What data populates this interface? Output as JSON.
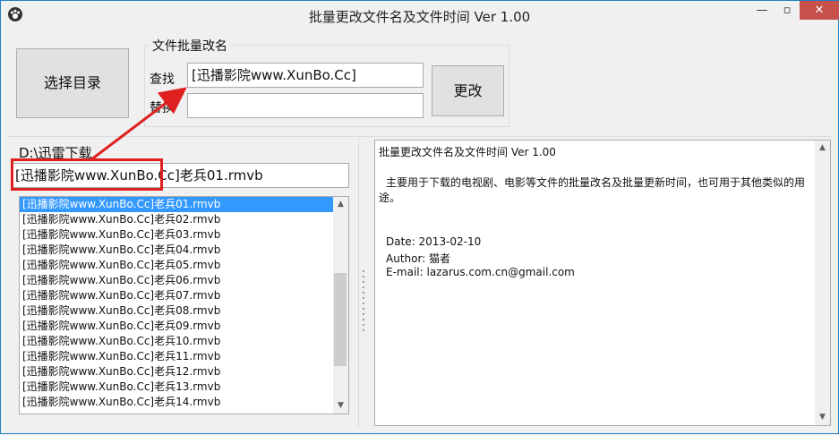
{
  "window": {
    "title": "批量更改文件名及文件时间 Ver 1.00",
    "min_label": "—",
    "max_label": "▫",
    "close_label": "✕"
  },
  "toolbar": {
    "select_dir_label": "选择目录",
    "change_label": "更改"
  },
  "rename_group": {
    "title": "文件批量改名",
    "find_label": "查找",
    "find_value": "[迅播影院www.XunBo.Cc]",
    "replace_label": "替换",
    "replace_value": ""
  },
  "left_pane": {
    "path": "D:\\迅雷下载",
    "current_name": "[迅播影院www.XunBo.Cc]老兵01.rmvb",
    "files": [
      "[迅播影院www.XunBo.Cc]老兵01.rmvb",
      "[迅播影院www.XunBo.Cc]老兵02.rmvb",
      "[迅播影院www.XunBo.Cc]老兵03.rmvb",
      "[迅播影院www.XunBo.Cc]老兵04.rmvb",
      "[迅播影院www.XunBo.Cc]老兵05.rmvb",
      "[迅播影院www.XunBo.Cc]老兵06.rmvb",
      "[迅播影院www.XunBo.Cc]老兵07.rmvb",
      "[迅播影院www.XunBo.Cc]老兵08.rmvb",
      "[迅播影院www.XunBo.Cc]老兵09.rmvb",
      "[迅播影院www.XunBo.Cc]老兵10.rmvb",
      "[迅播影院www.XunBo.Cc]老兵11.rmvb",
      "[迅播影院www.XunBo.Cc]老兵12.rmvb",
      "[迅播影院www.XunBo.Cc]老兵13.rmvb",
      "[迅播影院www.XunBo.Cc]老兵14.rmvb"
    ],
    "selected_index": 0
  },
  "info_pane": {
    "heading": "批量更改文件名及文件时间 Ver 1.00",
    "description_line1": "主要用于下载的电视剧、电影等文件的批量改名及批量更新时间，也可用于其他类似的用",
    "description_line2": "途。",
    "date": "Date: 2013-02-10",
    "author": "Author: 猫者",
    "email": "E-mail: lazarus.com.cn@gmail.com"
  },
  "icons": {
    "app_icon": "paw-icon",
    "scroll_up": "chevron-up-icon",
    "scroll_down": "chevron-down-icon"
  },
  "colors": {
    "selection": "#3399ff",
    "annotation_red": "#e02020",
    "close_button": "#c7504b"
  }
}
